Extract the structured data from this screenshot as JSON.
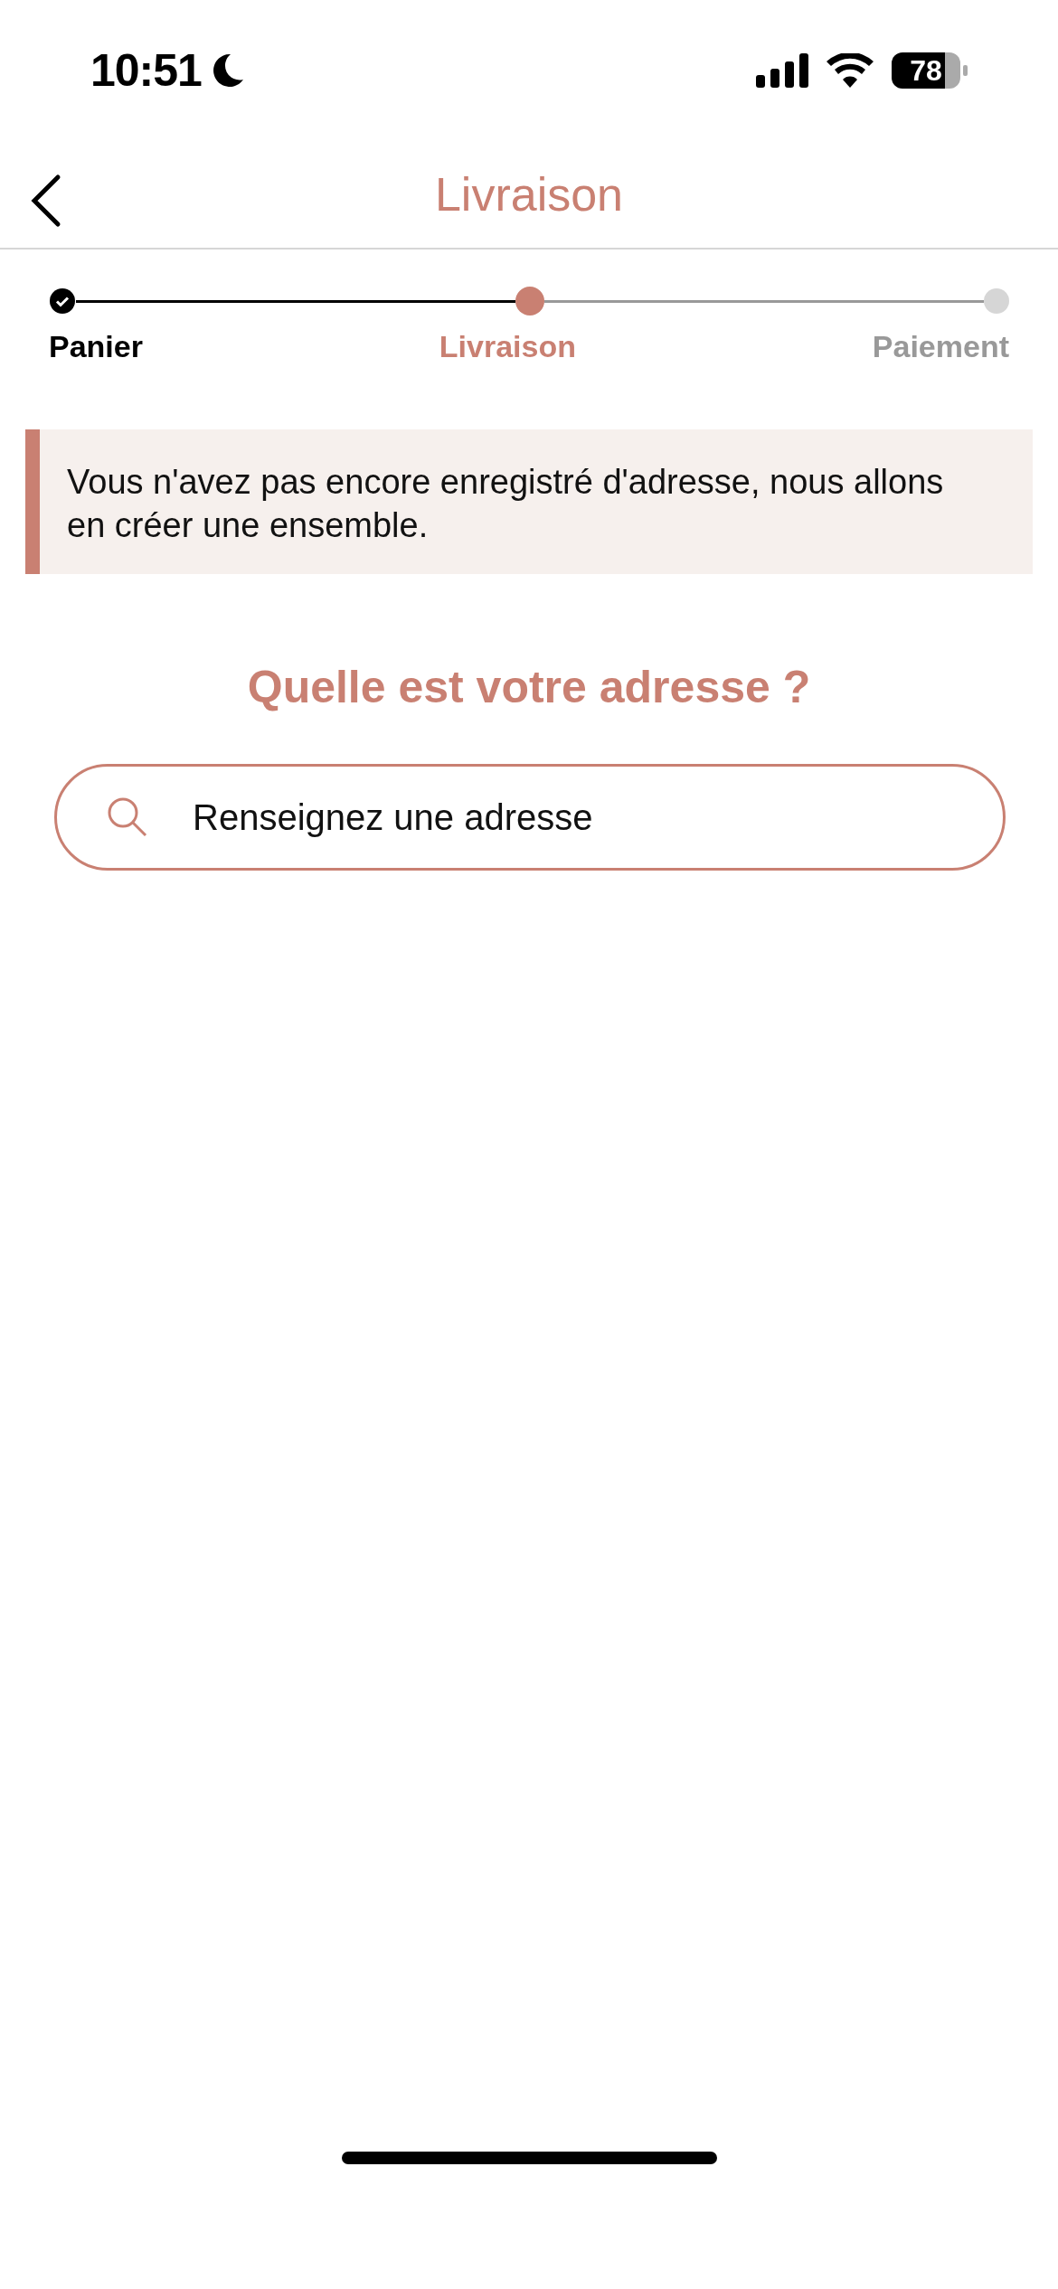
{
  "status_bar": {
    "time": "10:51",
    "battery": "78"
  },
  "nav": {
    "title": "Livraison"
  },
  "steps": [
    {
      "label": "Panier",
      "done": true,
      "selected": false
    },
    {
      "label": "Livraison",
      "done": false,
      "selected": true
    },
    {
      "label": "Paiement",
      "done": false,
      "selected": false
    }
  ],
  "notice": {
    "text": "Vous n'avez pas encore enregistré d'adresse, nous allons en créer une ensemble."
  },
  "heading": "Quelle est votre adresse ?",
  "search": {
    "placeholder": "Renseignez une adresse"
  }
}
